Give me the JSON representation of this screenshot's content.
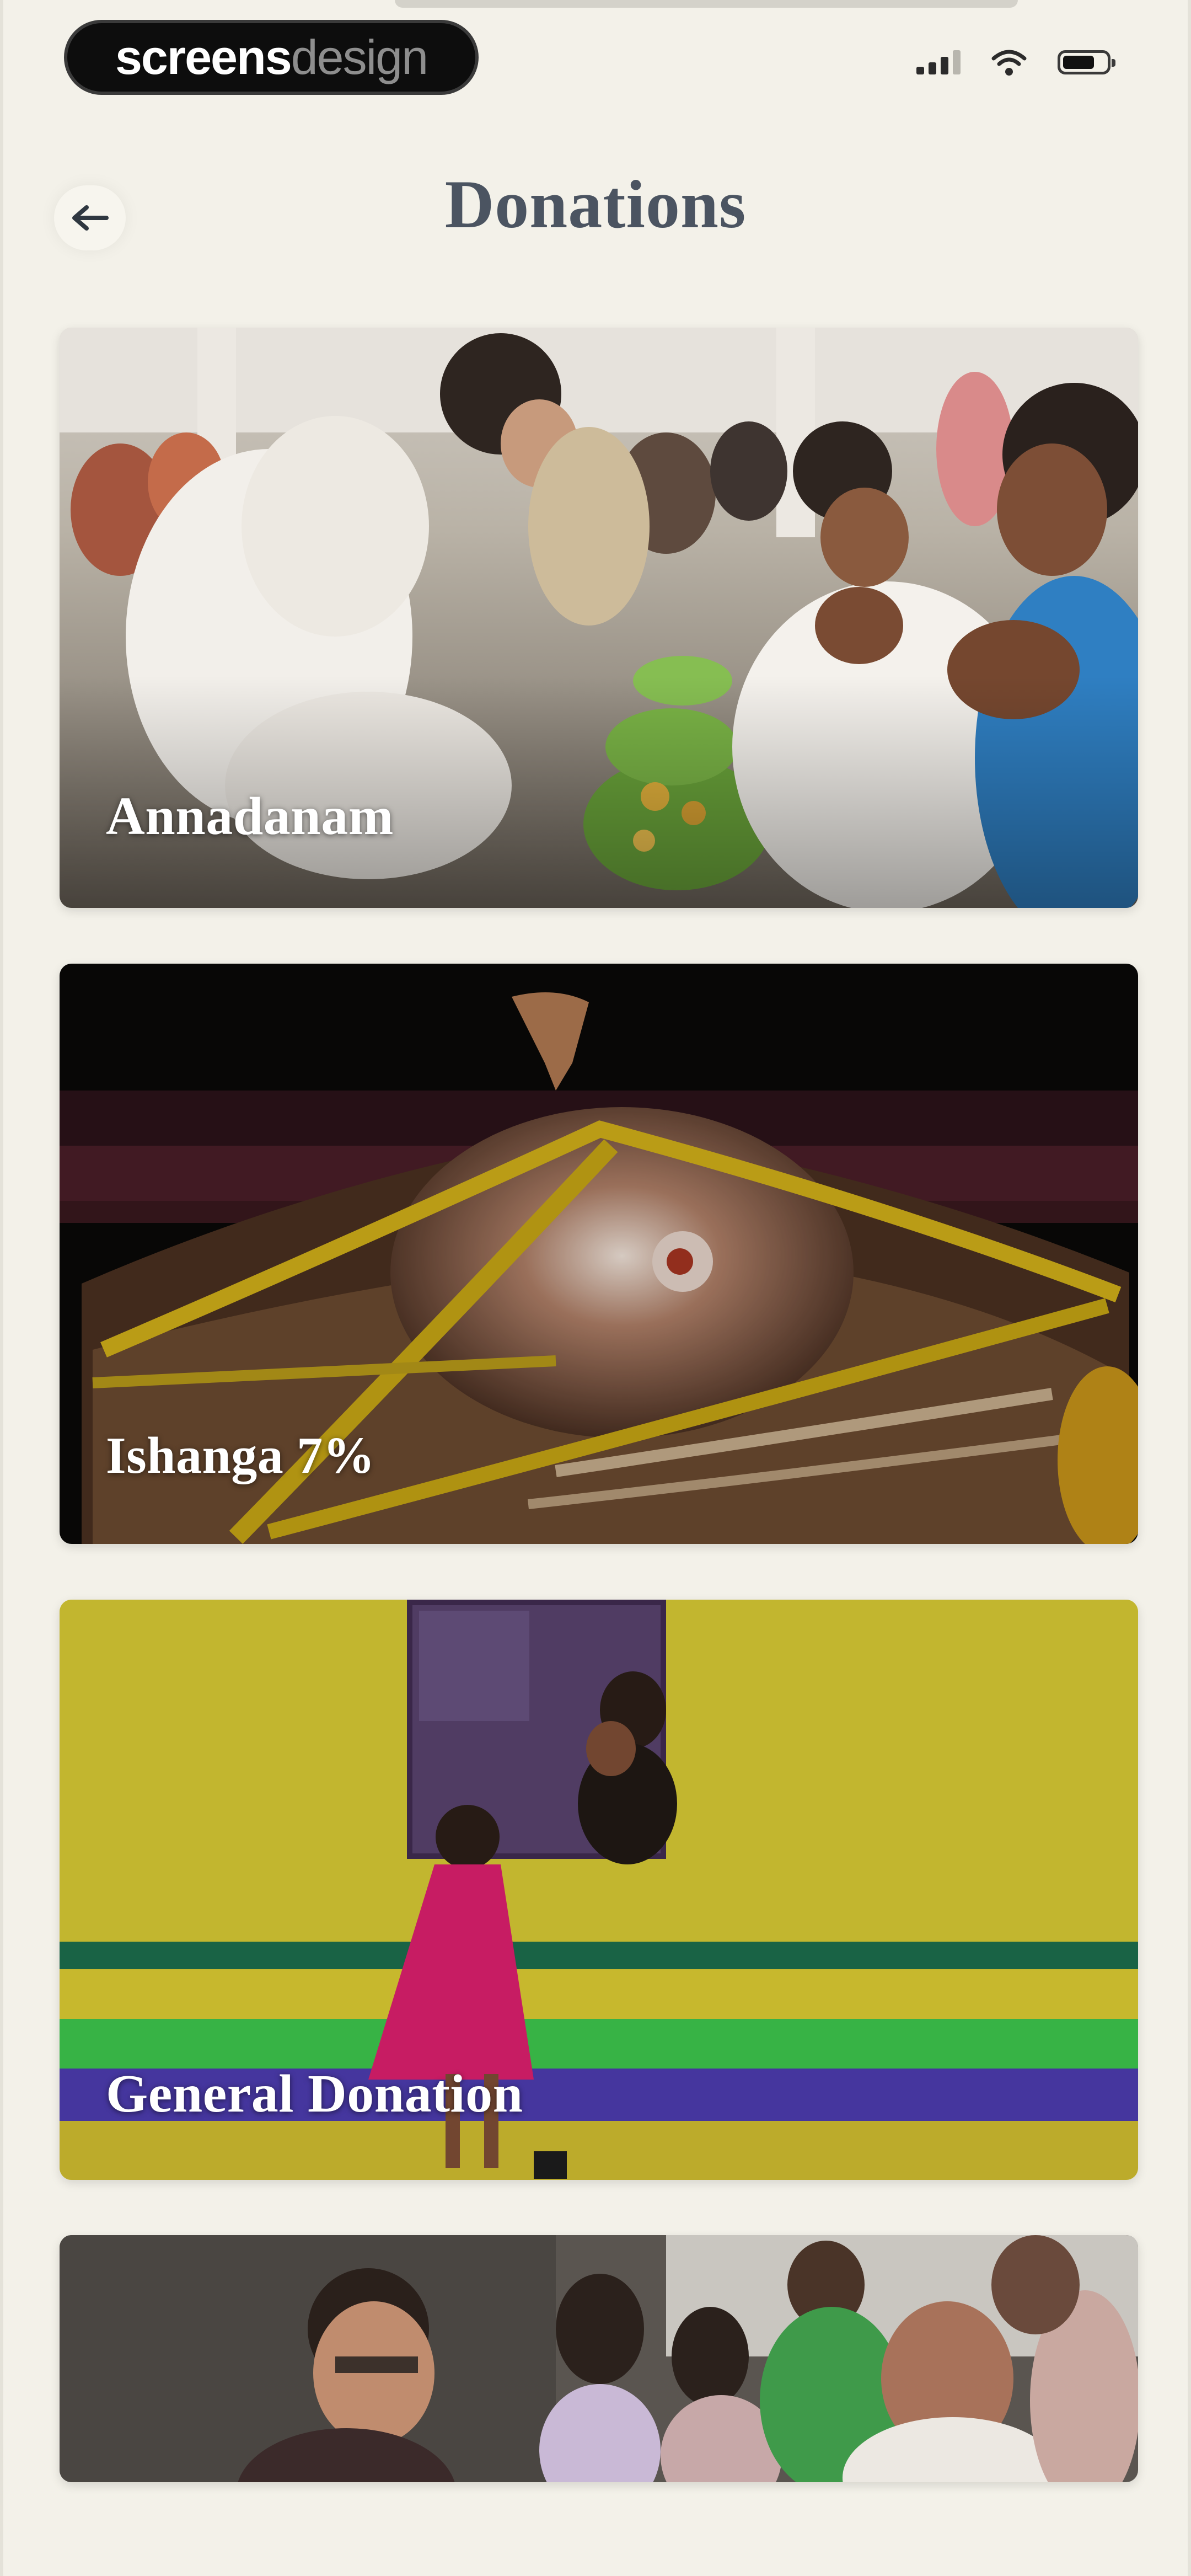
{
  "status_bar": {
    "brand_bold": "screens",
    "brand_light": "design",
    "icons": [
      "cellular-signal-icon",
      "wifi-icon",
      "battery-icon"
    ]
  },
  "header": {
    "back_icon": "arrow-left-icon",
    "title": "Donations"
  },
  "donations": [
    {
      "label": "Annadanam"
    },
    {
      "label": "Ishanga 7%"
    },
    {
      "label": "General Donation"
    },
    {
      "label": ""
    }
  ],
  "colors": {
    "background": "#f3f1e9",
    "title": "#4b5461",
    "card_label": "#ffffff"
  }
}
